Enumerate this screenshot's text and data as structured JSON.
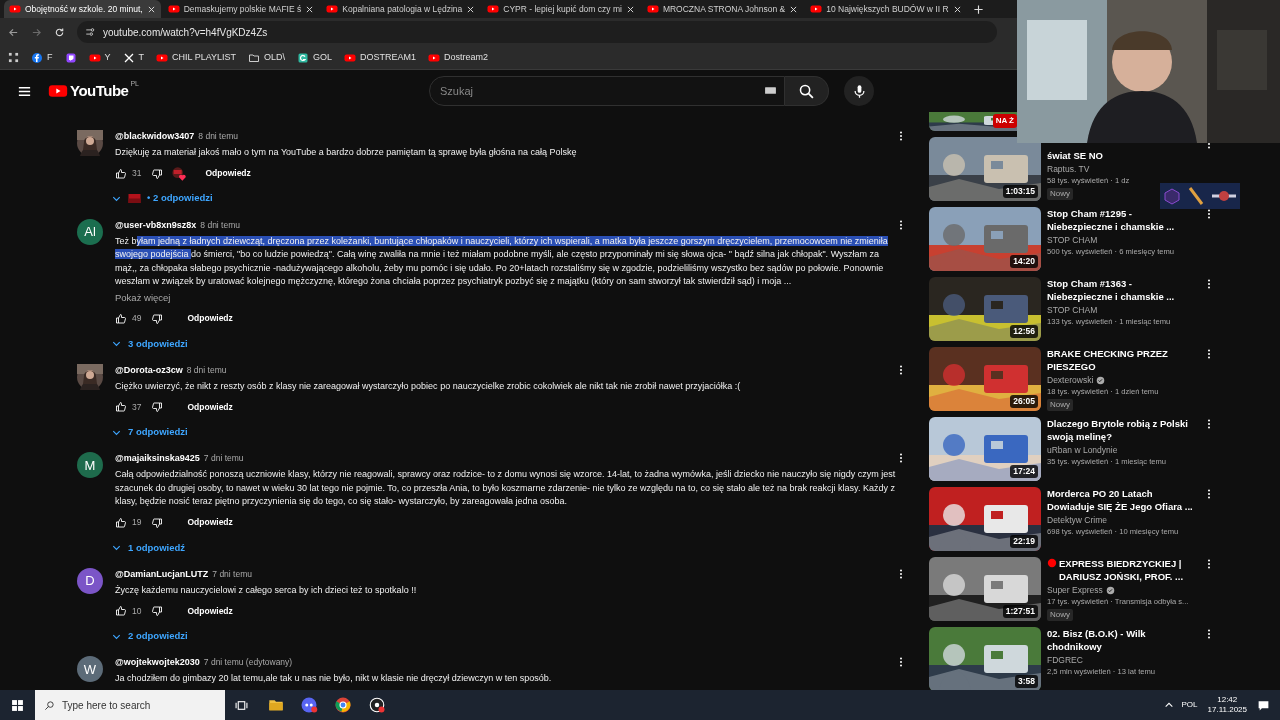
{
  "browser": {
    "tabs": [
      {
        "title": "Obojętność w szkole. 20 minut,",
        "selected": true
      },
      {
        "title": "Demaskujemy polskie MAFIE ś",
        "selected": false
      },
      {
        "title": "Kopalniana patologia w Lędzina",
        "selected": false
      },
      {
        "title": "CYPR - lepiej kupić dom czy mi",
        "selected": false
      },
      {
        "title": "MROCZNA STRONA Johnson &",
        "selected": false
      },
      {
        "title": "10 Największych BUDÓW w II R",
        "selected": false
      }
    ],
    "url": "youtube.com/watch?v=h4fVgKDz4Zs",
    "bookmarks": [
      {
        "kind": "facebook",
        "label": "F"
      },
      {
        "kind": "twitch"
      },
      {
        "kind": "youtube",
        "label": "Y"
      },
      {
        "kind": "x",
        "label": "T"
      },
      {
        "kind": "youtube",
        "label": "CHIL PLAYLIST"
      },
      {
        "kind": "folder",
        "label": "OLD\\"
      },
      {
        "kind": "g",
        "label": "GOL"
      },
      {
        "kind": "youtube",
        "label": "DOSTREAM1"
      },
      {
        "kind": "youtube",
        "label": "Dostream2"
      }
    ]
  },
  "header": {
    "logo": "YouTube",
    "country": "PL",
    "search": {
      "placeholder": "Szukaj"
    }
  },
  "comments": [
    {
      "handle": "@blackwidow3407",
      "time": "8 dni temu",
      "body": [
        {
          "text": "Dziękuję za materiał jakoś mało o tym na YouTube a bardzo dobrze pamiętam tą sprawę była głośna na całą Polskę",
          "selected": false
        }
      ],
      "likes": "31",
      "hearted": true,
      "reply": "Odpowiedz",
      "replies": "• 2 odpowiedzi",
      "replies_avatar": true
    },
    {
      "letter": "Al",
      "color": "#1b6e4f",
      "handle": "@user-vb8xn9sz8x",
      "time": "8 dni temu",
      "body": [
        {
          "text": "Też b",
          "selected": false
        },
        {
          "text": "yłam jedną z ładnych dziewcząt, dręczona przez koleżanki, buntujące chłopaków i nauczycieli, którzy ich wspierali, a matka była jeszcze gorszym dręczycielem, przemocowcem nie zmieniła swojego podejścia ",
          "selected": true
        },
        {
          "text": "do śmierci, \"bo co ludzie powiedzą\". Całą winę zwaliła na mnie i też miałam podobne myśli, ale często przypominały mi się słowa ojca- \" bądź silna jak chłopak\". Wyszłam za mąż,, za chłopaka słabego psychicznie -nadużywającego alkoholu, żeby mu pomóc i się udało. Po 20+latach rozstaliśmy się w zgodzie, podzieliliśmy wszystko bez sądów po połowie. Ponownie weszłam w związek by uratować kolejnego mężczyznę, którego żona chciała poprzez psychiatryk pozbyć się z majątku (który on sam stworzył tak stwierdził sąd) i moja ...",
          "selected": false
        }
      ],
      "more": "Pokaż więcej",
      "likes": "49",
      "reply": "Odpowiedz",
      "replies": "3 odpowiedzi"
    },
    {
      "handle": "@Dorota-oz3cw",
      "time": "8 dni temu",
      "body": [
        {
          "text": "Ciężko uwierzyć, że nikt z reszty osób z klasy nie zareagował wystarczyło pobiec po nauczycielke zrobic cokolwiek ale nikt tak nie zrobił nawet przyjaciółka :(",
          "selected": false
        }
      ],
      "likes": "37",
      "reply": "Odpowiedz",
      "replies": "7 odpowiedzi"
    },
    {
      "letter": "M",
      "color": "#1e6b4c",
      "handle": "@majaiksinska9425",
      "time": "7 dni temu",
      "body": [
        {
          "text": "Całą odpowiedzialność ponoszą uczniowie klasy, którzy nie reagowali, sprawcy oraz rodzice- to z domu wynosi się wzorce. 14-lat, to żadna wymówka, jeśli dziecko nie nauczyło się nigdy czym jest szacunek do drugiej osoby, to nawet w wieku 30 lat tego nie pojmie. To, co przeszła Ania, to było koszmarne zdarzenie- nie tylko ze względu na to, co się stało ale też na brak reakcji klasy. Każdy z klasy, będzie nosić teraz piętno przyczynienia się do tego, co się stało- wystarczyło, by zareagowała jedna osoba.",
          "selected": false
        }
      ],
      "likes": "19",
      "reply": "Odpowiedz",
      "replies": "1 odpowiedź"
    },
    {
      "letter": "D",
      "color": "#7b55c7",
      "handle": "@DamianLucjanLUTZ",
      "time": "7 dni temu",
      "body": [
        {
          "text": "Życzę każdemu nauczycielowi z całego serca by ich dzieci też to spotkalo !!",
          "selected": false
        }
      ],
      "likes": "10",
      "reply": "Odpowiedz",
      "replies": "2 odpowiedzi"
    },
    {
      "letter": "W",
      "color": "#5c6b78",
      "handle": "@wojtekwojtek2030",
      "time": "7 dni temu (edytowany)",
      "body": [
        {
          "text": "Ja chodziłem do gimbazy 20 lat temu,ale tak u nas nie było, nikt w klasie nie dręczył dziewczyn w ten sposób.",
          "selected": false
        }
      ]
    }
  ],
  "sidebar": [
    {
      "kind": "cut",
      "badge": "NA Ż"
    },
    {
      "kind": "title_hidden",
      "title": "świat SE NO",
      "channel": "Raptus. TV",
      "meta": "58 tys. wyświetleń · 1 dz",
      "duration": "1:03:15",
      "new": "Nowy"
    },
    {
      "kind": "video",
      "title": "Stop Cham #1295 - Niebezpieczne i chamskie ...",
      "channel": "STOP CHAM",
      "meta": "500 tys. wyświetleń · 6 miesięcy temu",
      "duration": "14:20"
    },
    {
      "kind": "video",
      "title": "Stop Cham #1363 - Niebezpieczne i chamskie ...",
      "channel": "STOP CHAM",
      "meta": "133 tys. wyświetleń · 1 miesiąc temu",
      "duration": "12:56"
    },
    {
      "kind": "video",
      "title": "BRAKE CHECKING PRZEZ PIESZEGO",
      "channel": "Dexterowski",
      "verified": true,
      "meta": "18 tys. wyświetleń · 1 dzień temu",
      "duration": "26:05",
      "new": "Nowy"
    },
    {
      "kind": "video",
      "title": "Dlaczego Brytole robią z Polski swoją melinę?",
      "channel": "uRban w Londynie",
      "meta": "35 tys. wyświetleń · 1 miesiąc temu",
      "duration": "17:24"
    },
    {
      "kind": "video",
      "title": "Morderca PO 20 Latach Dowiaduje SIĘ ŻE Jego Ofiara ...",
      "channel": "Detektyw Crime",
      "meta": "698 tys. wyświetleń · 10 miesięcy temu",
      "duration": "22:19"
    },
    {
      "kind": "video",
      "live_dot": true,
      "title": "EXPRESS BIEDRZYCKIEJ | DARIUSZ JOŃSKI, PROF. ...",
      "channel": "Super Express",
      "verified": true,
      "meta": "17 tys. wyświetleń · Transmisja odbyła s...",
      "duration": "1:27:51",
      "new": "Nowy"
    },
    {
      "kind": "video",
      "title": "02. Bisz (B.O.K) - Wilk chodnikowy",
      "channel": "FDGREC",
      "meta": "2,5 mln wyświetleń · 13 lat temu",
      "duration": "3:58"
    }
  ],
  "taskbar": {
    "search": {
      "placeholder": "Type here to search"
    },
    "language": "POL",
    "time": "12:42",
    "date": "17.11.2025"
  }
}
